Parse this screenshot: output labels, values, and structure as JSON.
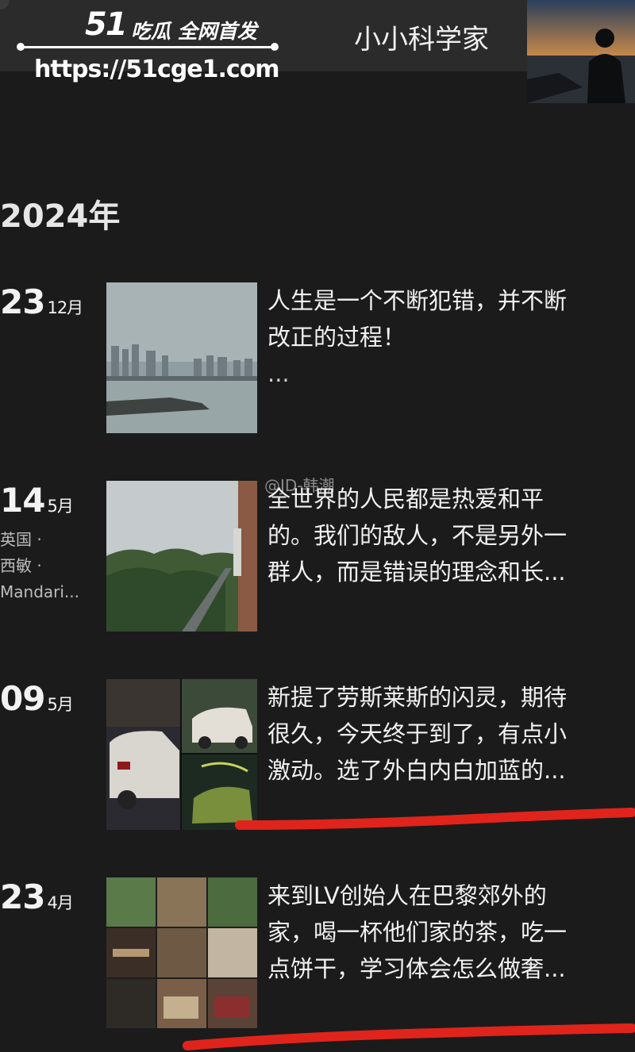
{
  "watermark": {
    "brand_num": "51",
    "brand_tag": "吃瓜 全网首发",
    "url": "https://51cge1.com"
  },
  "profile": {
    "name": "小小科学家"
  },
  "timeline": {
    "year": "2024年",
    "entries": [
      {
        "day": "23",
        "month": "12月",
        "location": "",
        "text_line1": "人生是一个不断犯错，并不断",
        "text_line2": "改正的过程！",
        "text_line3": "..."
      },
      {
        "day": "14",
        "month": "5月",
        "location": "英国 · 西敏 · Mandari...",
        "weibo_tag": "@JD-韩潮",
        "text_line1": "全世界的人民都是热爱和平",
        "text_line2": "的。我们的敌人，不是另外一",
        "text_line3": "群人，而是错误的理念和长..."
      },
      {
        "day": "09",
        "month": "5月",
        "location": "",
        "text_line1": "新提了劳斯莱斯的闪灵，期待",
        "text_line2": "很久，今天终于到了，有点小",
        "text_line3": "激动。选了外白内白加蓝的..."
      },
      {
        "day": "23",
        "month": "4月",
        "location": "",
        "text_line1": "来到LV创始人在巴黎郊外的",
        "text_line2": "家，喝一杯他们家的茶，吃一",
        "text_line3": "点饼干，学习体会怎么做奢..."
      }
    ]
  },
  "colors": {
    "background": "#1b1b1b",
    "top_bar": "#2b2b2b",
    "text": "#f2f2f2",
    "annotation_red": "#e0241c"
  }
}
